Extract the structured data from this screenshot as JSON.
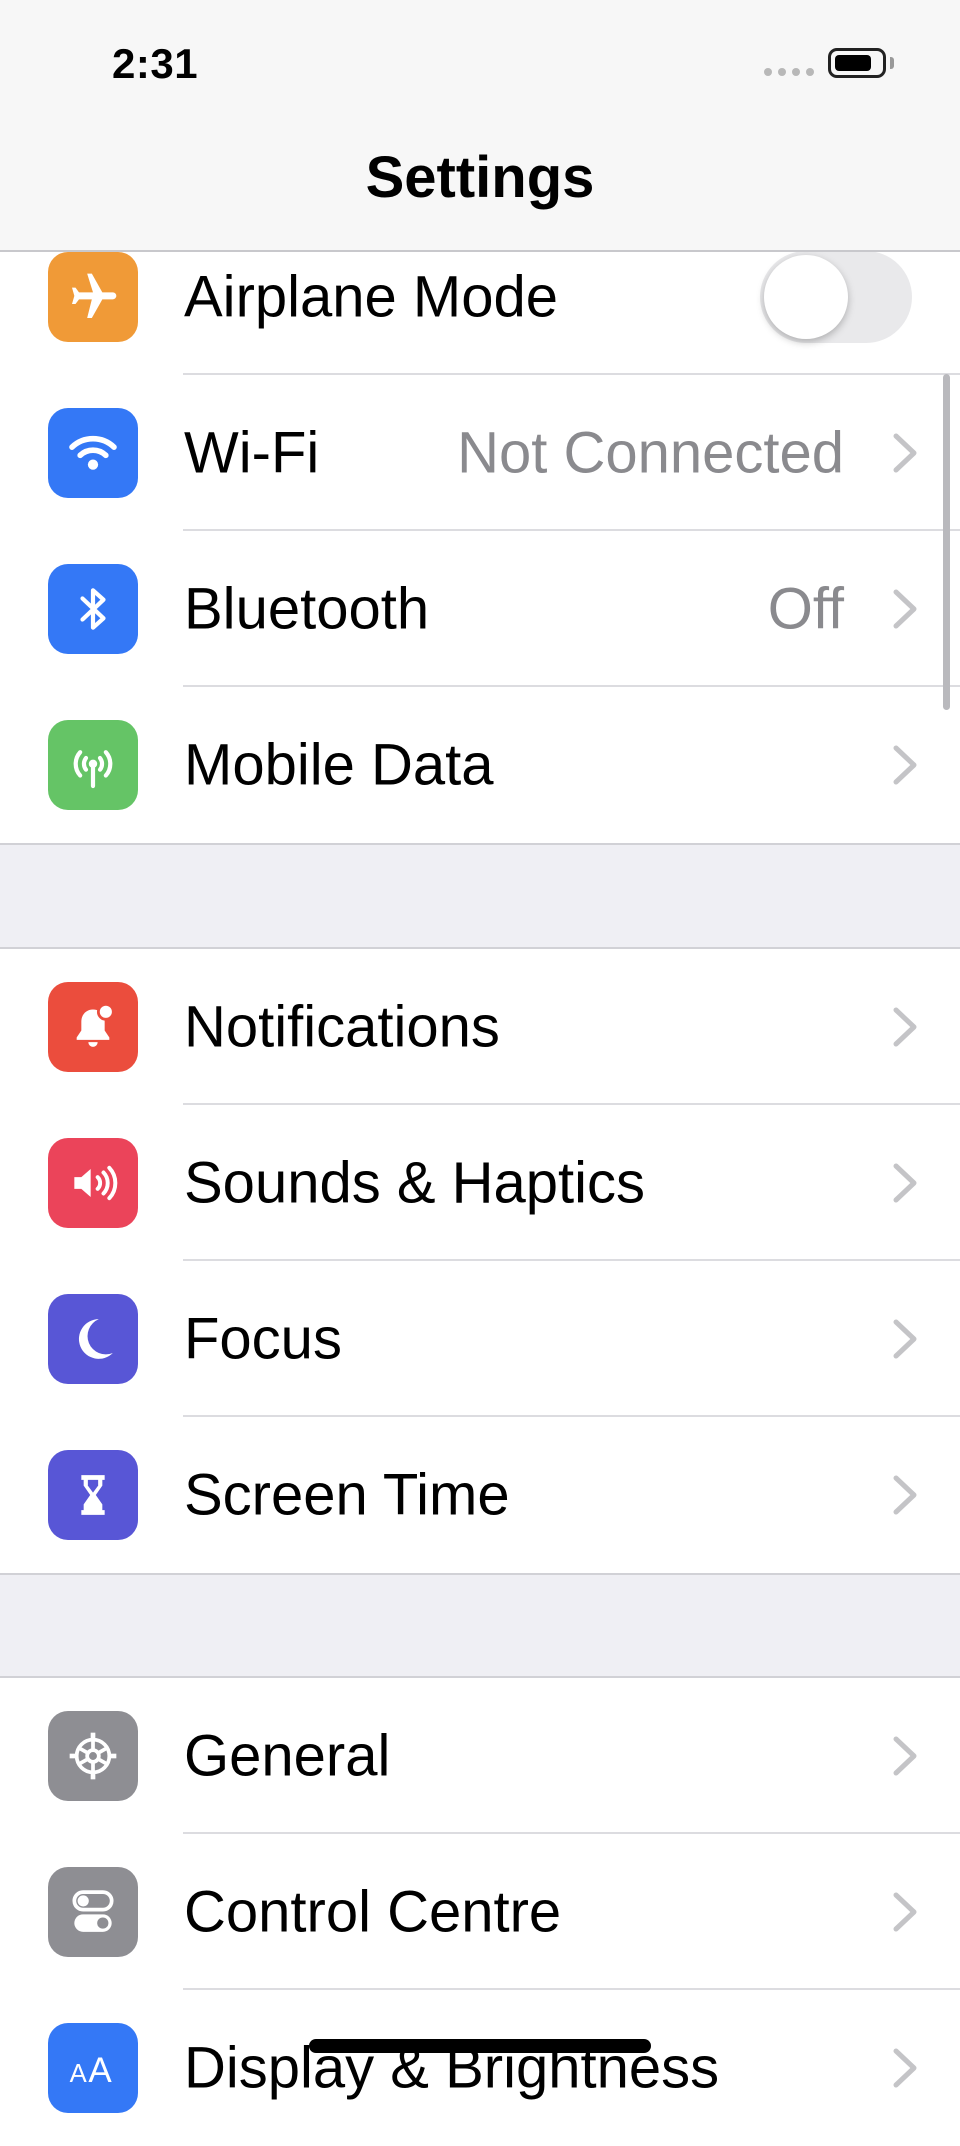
{
  "status_bar": {
    "time": "2:31"
  },
  "nav": {
    "title": "Settings"
  },
  "groups": [
    {
      "items": [
        {
          "label": "Airplane Mode",
          "icon": "airplane-icon",
          "color": "#f09a37",
          "control": "toggle",
          "toggle_on": false
        },
        {
          "label": "Wi-Fi",
          "value": "Not Connected",
          "icon": "wifi-icon",
          "color": "#3478f6"
        },
        {
          "label": "Bluetooth",
          "value": "Off",
          "icon": "bluetooth-icon",
          "color": "#3478f6"
        },
        {
          "label": "Mobile Data",
          "icon": "antenna-icon",
          "color": "#65c466"
        }
      ]
    },
    {
      "items": [
        {
          "label": "Notifications",
          "icon": "bell-icon",
          "color": "#eb4d3d"
        },
        {
          "label": "Sounds & Haptics",
          "icon": "speaker-icon",
          "color": "#eb445a"
        },
        {
          "label": "Focus",
          "icon": "moon-icon",
          "color": "#5856d6"
        },
        {
          "label": "Screen Time",
          "icon": "hourglass-icon",
          "color": "#5856d6"
        }
      ]
    },
    {
      "items": [
        {
          "label": "General",
          "icon": "gear-icon",
          "color": "#8e8e93"
        },
        {
          "label": "Control Centre",
          "icon": "switches-icon",
          "color": "#8e8e93"
        },
        {
          "label": "Display & Brightness",
          "icon": "text-size-icon",
          "color": "#3478f6"
        }
      ]
    }
  ]
}
